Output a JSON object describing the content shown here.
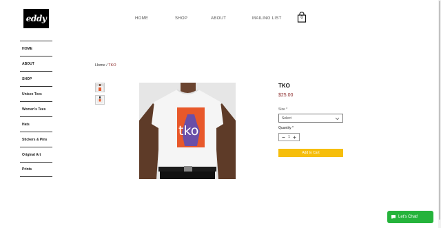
{
  "brand": {
    "logo_text": "eddy"
  },
  "topnav": {
    "items": [
      "HOME",
      "SHOP",
      "ABOUT",
      "MAILING LIST"
    ]
  },
  "cart": {
    "count": "0"
  },
  "sidebar": {
    "items": [
      "HOME",
      "ABOUT",
      "SHOP",
      "Unisex Tees",
      "Women's Tees",
      "Hats",
      "Stickers & Pins",
      "Original Art",
      "Prints"
    ]
  },
  "breadcrumb": {
    "home": "Home",
    "separator": "/",
    "current": "TKO"
  },
  "product": {
    "name": "TKO",
    "price": "$25.00",
    "size_label": "Size *",
    "size_value": "Select",
    "quantity_label": "Quantity *",
    "quantity_value": "1",
    "add_to_cart": "Add to Cart",
    "shirt_graphic_text": "tko"
  },
  "chat": {
    "label": "Let's Chat!"
  },
  "colors": {
    "accent": "#f6be0b",
    "price": "#8b2a2a",
    "chat": "#25b33b"
  },
  "icons": [
    "cart-icon",
    "chevron-down-icon",
    "minus-icon",
    "plus-icon",
    "chat-icon"
  ]
}
